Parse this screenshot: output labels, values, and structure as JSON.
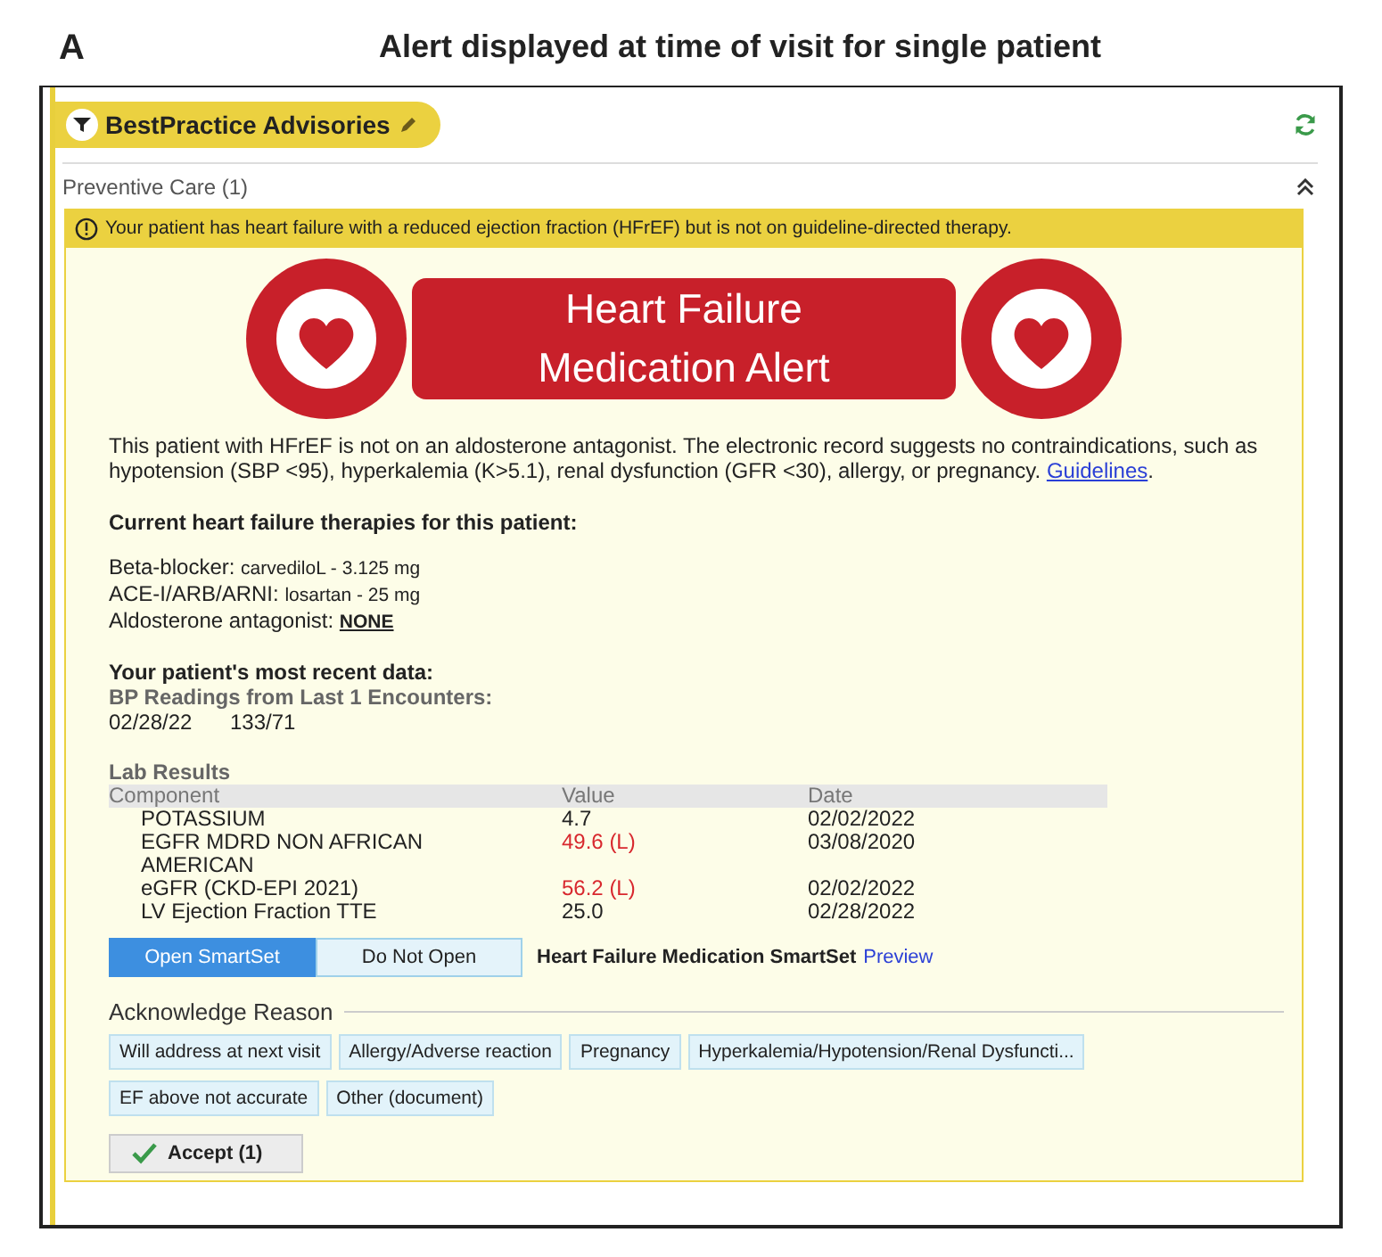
{
  "figure": {
    "label": "A",
    "title": "Alert displayed at time of visit for single patient"
  },
  "panel": {
    "title": "BestPractice Advisories",
    "section": {
      "label": "Preventive Care (1)",
      "expanded": true
    },
    "banner": "Your patient has heart failure with a reduced ejection fraction (HFrEF) but is not on guideline-directed therapy.",
    "alert_title": [
      "Heart Failure",
      "Medication Alert"
    ],
    "description": "This patient with HFrEF is not on an aldosterone antagonist. The electronic record suggests no contraindications, such as hypotension (SBP <95), hyperkalemia (K>5.1), renal dysfunction (GFR <30), allergy, or pregnancy.",
    "description_link": "Guidelines",
    "description_end": ".",
    "therapies_heading": "Current heart failure therapies for this patient:",
    "therapies": [
      {
        "label": "Beta-blocker:",
        "value": "carvediloL - 3.125 mg",
        "missing": false
      },
      {
        "label": "ACE-I/ARB/ARNI:",
        "value": "losartan - 25 mg",
        "missing": false
      },
      {
        "label": "Aldosterone antagonist:",
        "value": "NONE",
        "missing": true
      }
    ],
    "recent_heading": "Your patient's most recent data:",
    "bp_heading": "BP Readings from Last 1 Encounters:",
    "bp_readings": [
      {
        "date": "02/28/22",
        "value": "133/71"
      }
    ],
    "labs": {
      "title": "Lab Results",
      "columns": [
        "Component",
        "Value",
        "Date"
      ],
      "rows": [
        {
          "component": "POTASSIUM",
          "value": "4.7",
          "date": "02/02/2022",
          "abnormal": false
        },
        {
          "component": "EGFR MDRD NON AFRICAN AMERICAN",
          "value": "49.6 (L)",
          "date": "03/08/2020",
          "abnormal": true
        },
        {
          "component": "eGFR (CKD-EPI 2021)",
          "value": "56.2 (L)",
          "date": "02/02/2022",
          "abnormal": true
        },
        {
          "component": "LV Ejection Fraction TTE",
          "value": "25.0",
          "date": "02/28/2022",
          "abnormal": false
        }
      ]
    },
    "choices": [
      {
        "label": "Open SmartSet",
        "selected": true
      },
      {
        "label": "Do Not Open",
        "selected": false
      }
    ],
    "smartset": "Heart Failure Medication SmartSet",
    "preview": "Preview",
    "acknowledge": {
      "legend": "Acknowledge Reason",
      "reasons": [
        {
          "label": "Will address at next visit",
          "selected": false
        },
        {
          "label": "Allergy/Adverse reaction",
          "selected": false
        },
        {
          "label": "Pregnancy",
          "selected": false
        },
        {
          "label": "Hyperkalemia/Hypotension/Renal Dysfuncti...",
          "selected": false
        },
        {
          "label": "EF above not accurate",
          "selected": false
        },
        {
          "label": "Other (document)",
          "selected": false
        }
      ]
    },
    "accept": "Accept (1)"
  }
}
